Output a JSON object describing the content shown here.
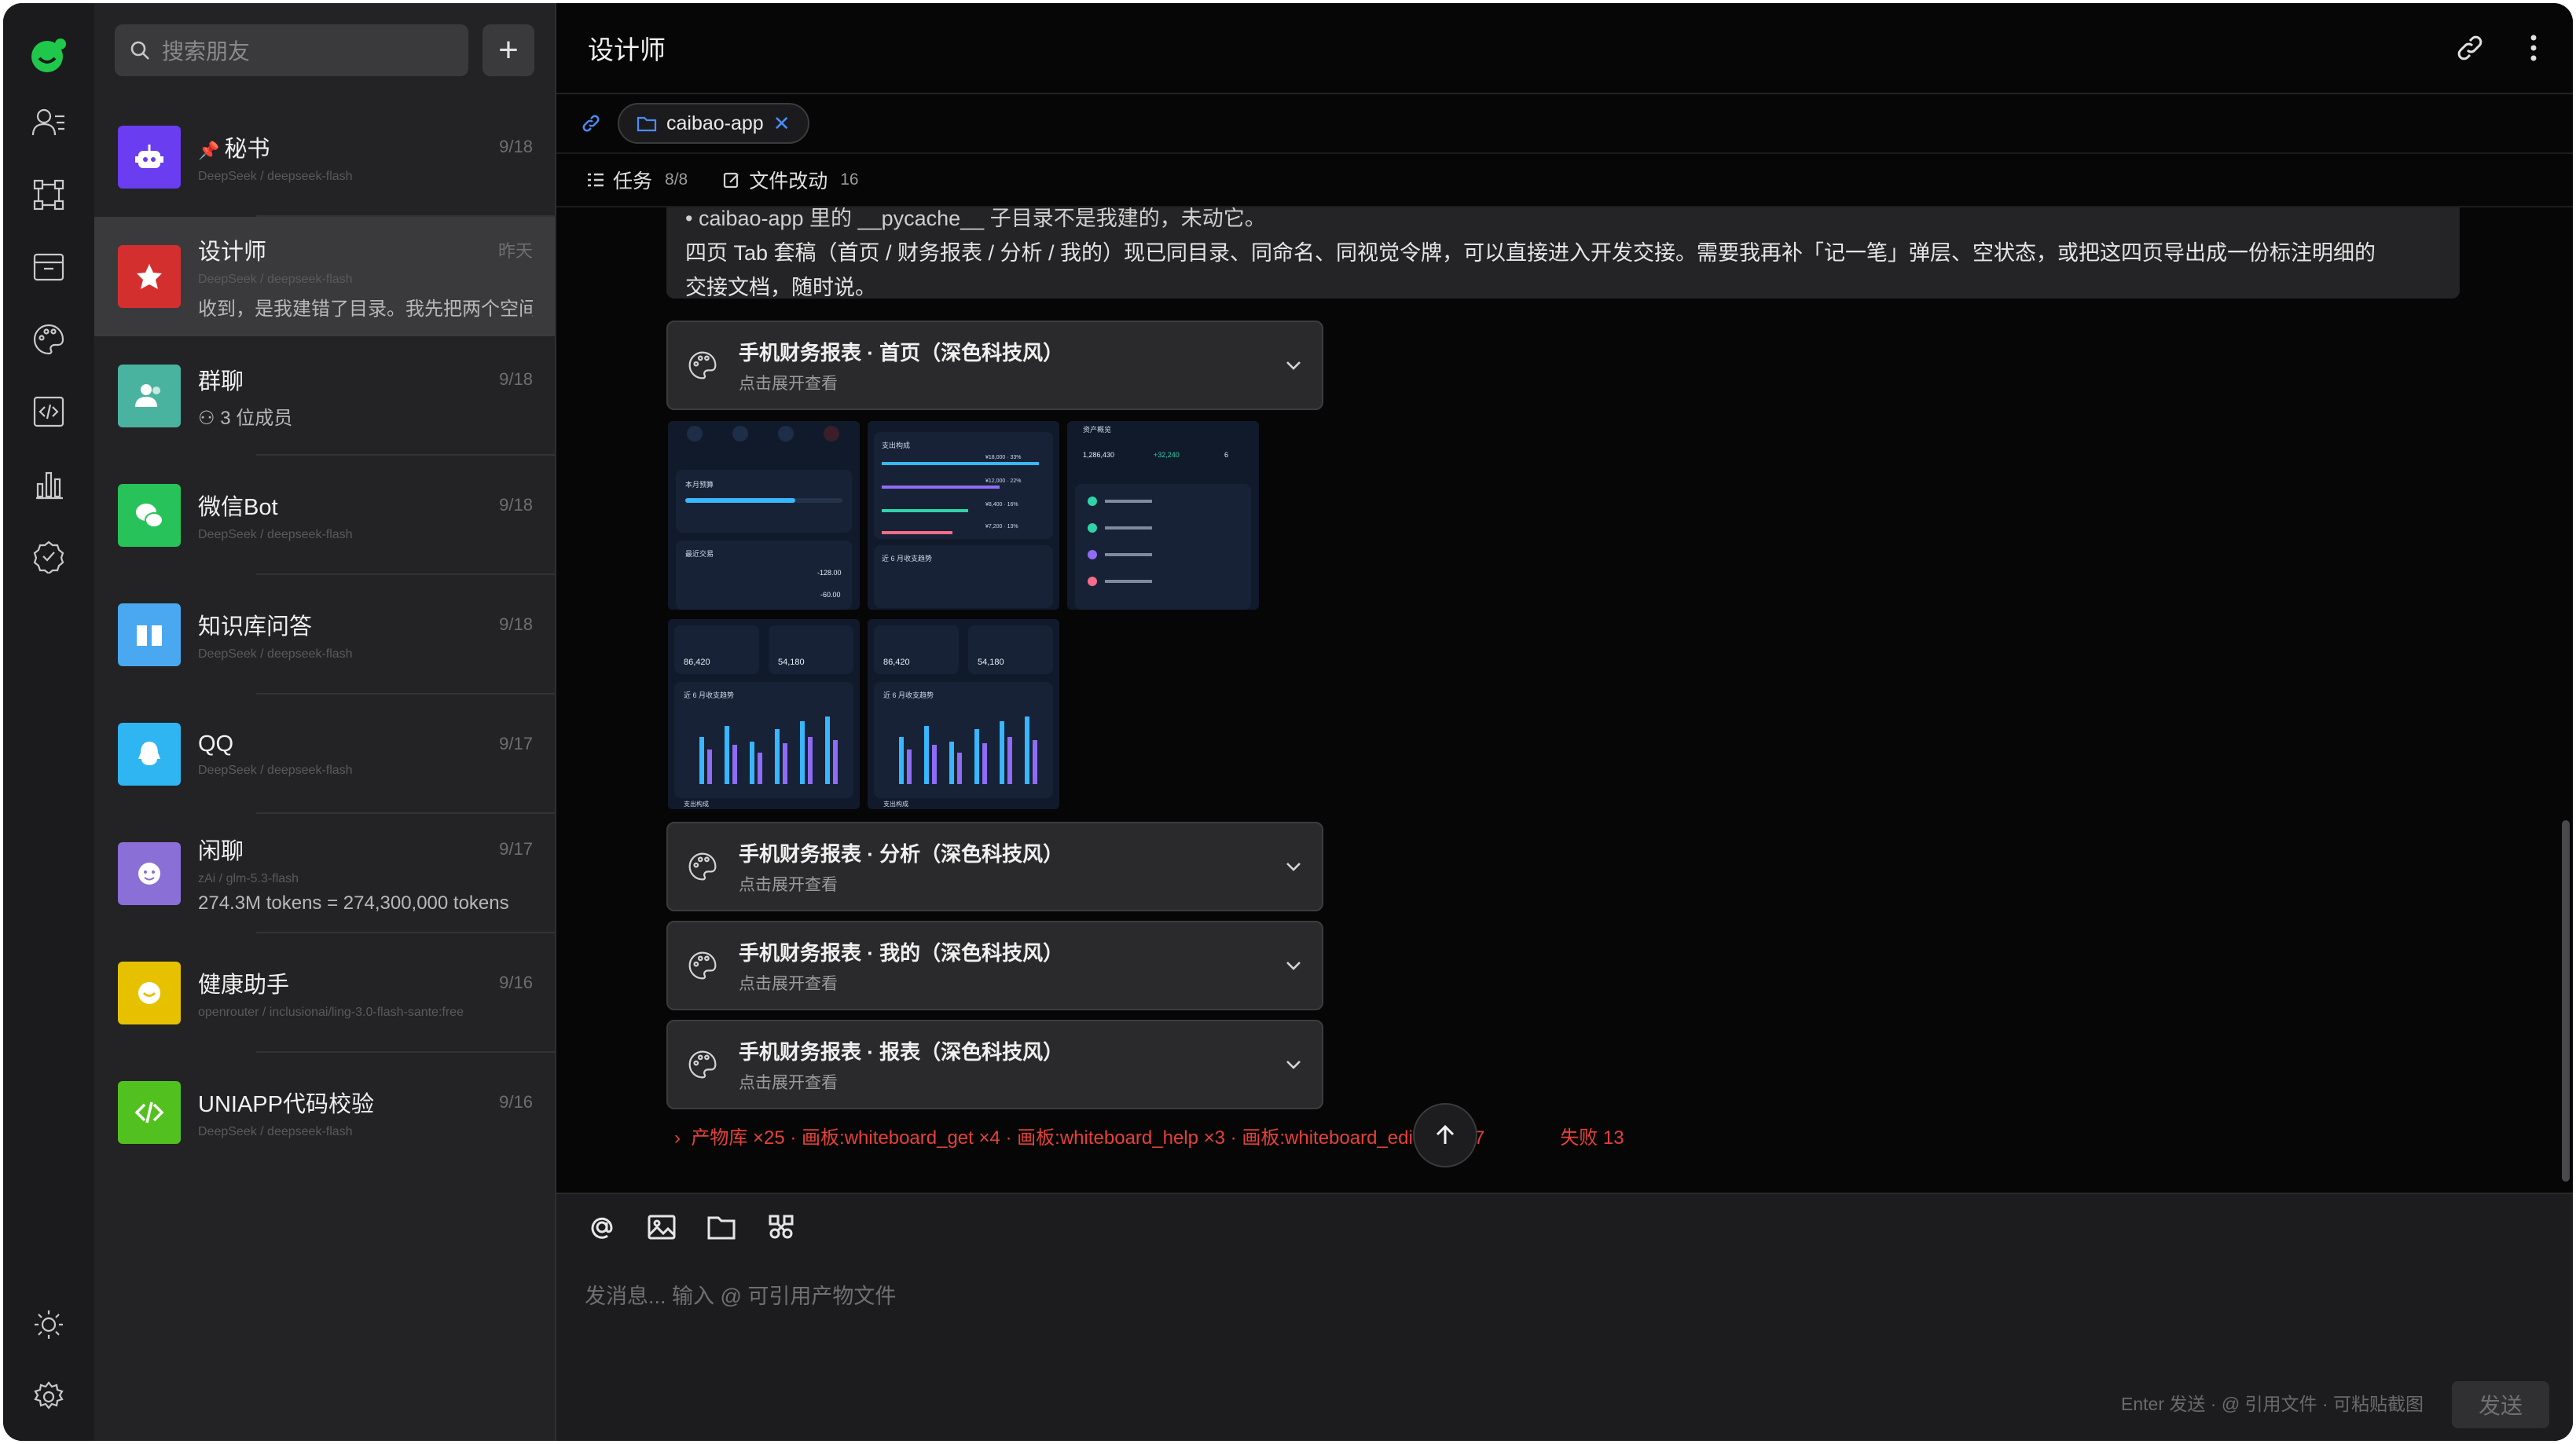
{
  "search": {
    "placeholder": "搜索朋友"
  },
  "add_label": "+",
  "chats": [
    {
      "name": "秘书",
      "sub": "DeepSeek / deepseek-flash",
      "date": "9/18",
      "pinned": true,
      "color": "#6a3df0"
    },
    {
      "name": "设计师",
      "sub": "DeepSeek / deepseek-flash",
      "date": "昨天",
      "preview": "收到，是我建错了目录。我先把两个空间",
      "color": "#d32f2f"
    },
    {
      "name": "群聊",
      "sub": "",
      "date": "9/18",
      "preview": "3 位成员",
      "color": "#4ab3a0"
    },
    {
      "name": "微信Bot",
      "sub": "DeepSeek / deepseek-flash",
      "date": "9/18",
      "color": "#27c25a"
    },
    {
      "name": "知识库问答",
      "sub": "DeepSeek / deepseek-flash",
      "date": "9/18",
      "color": "#4aa8f0"
    },
    {
      "name": "QQ",
      "sub": "DeepSeek / deepseek-flash",
      "date": "9/17",
      "color": "#2fb5f2"
    },
    {
      "name": "闲聊",
      "sub": "zAi / glm-5.3-flash",
      "date": "9/17",
      "preview": "274.3M tokens = 274,300,000 tokens",
      "color": "#8a6fd6"
    },
    {
      "name": "健康助手",
      "sub": "openrouter / inclusionai/ling-3.0-flash-sante:free",
      "date": "9/16",
      "color": "#e6c100"
    },
    {
      "name": "UNIAPP代码校验",
      "sub": "DeepSeek / deepseek-flash",
      "date": "9/16",
      "color": "#52c11f"
    }
  ],
  "main": {
    "title": "设计师",
    "path_chip": "caibao-app",
    "tasks_label": "任务",
    "tasks_count": "8/8",
    "files_label": "文件改动",
    "files_count": "16",
    "message_line0": "• caibao-app 里的 __pycache__ 子目录不是我建的，未动它。",
    "message_line1": "四页 Tab 套稿（首页 / 财务报表 / 分析 / 我的）现已同目录、同命名、同视觉令牌，可以直接进入开发交接。需要我再补「记一笔」弹层、空状态，或把这四页导出成一份标注明细的",
    "message_line2": "交接文档，随时说。",
    "cards": [
      {
        "title": "手机财务报表 · 首页（深色科技风）",
        "hint": "点击展开查看"
      },
      {
        "title": "手机财务报表 · 分析（深色科技风）",
        "hint": "点击展开查看"
      },
      {
        "title": "手机财务报表 · 我的（深色科技风）",
        "hint": "点击展开查看"
      },
      {
        "title": "手机财务报表 · 报表（深色科技风）",
        "hint": "点击展开查看"
      }
    ],
    "status_line": "产物库 ×25 · 画板:whiteboard_get ×4 · 画板:whiteboard_help ×3 · 画板:whiteboard_edit ×5 等 7",
    "status_fail": "失败 13"
  },
  "composer": {
    "placeholder": "发消息... 输入 @ 可引用产物文件",
    "hint": "Enter 发送 · @ 引用文件 · 可粘贴截图",
    "send_label": "发送"
  },
  "thumbs": {
    "t1": {
      "budget_title": "本月预算",
      "recent_title": "最近交易",
      "amount1": "-128.00",
      "amount2": "-60.00"
    },
    "t2": {
      "title": "支出构成",
      "trend": "近 6 月收支趋势",
      "v1": "¥18,000 · 33%",
      "v2": "¥12,000 · 22%",
      "v3": "¥8,400 · 16%",
      "v4": "¥7,200 · 13%"
    },
    "t3": {
      "title": "资产概览",
      "total": "1,286,430",
      "income": "+32,240",
      "count": "6"
    },
    "t4": {
      "income": "86,420",
      "expense": "54,180",
      "trend": "近 6 月收支趋势",
      "footer": "支出构成"
    },
    "t5": {
      "income": "86,420",
      "expense": "54,180",
      "trend": "近 6 月收支趋势",
      "footer": "支出构成"
    }
  }
}
